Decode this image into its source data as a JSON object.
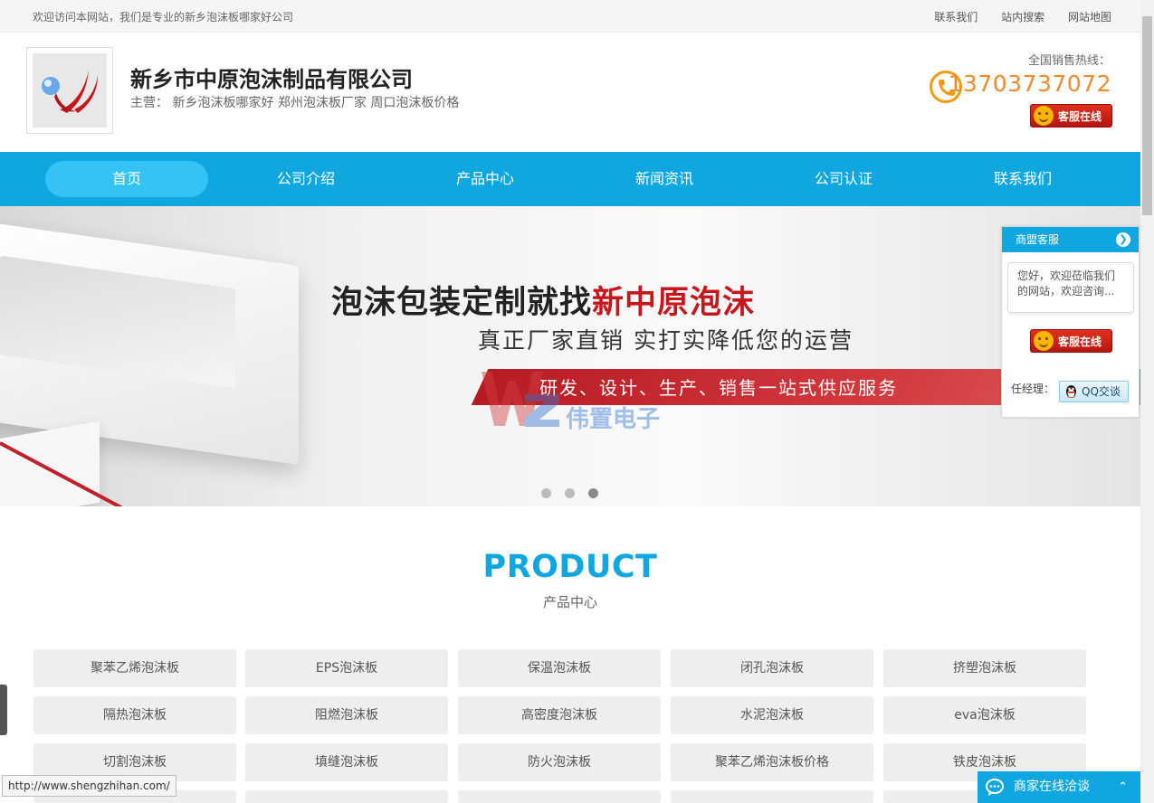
{
  "topbar": {
    "welcome": "欢迎访问本网站，我们是专业的新乡泡沫板哪家好公司",
    "links": [
      "联系我们",
      "站内搜索",
      "网站地图"
    ]
  },
  "header": {
    "company_name": "新乡市中原泡沫制品有限公司",
    "main_business": "主营： 新乡泡沫板哪家好 郑州泡沫板厂家 周口泡沫板价格",
    "hotline_label": "全国销售热线：",
    "phone": "13703737072",
    "kf_label": "客服在线"
  },
  "nav": {
    "items": [
      "首页",
      "公司介绍",
      "产品中心",
      "新闻资讯",
      "公司认证",
      "联系我们"
    ],
    "active_index": 0
  },
  "banner": {
    "headline_black": "泡沫包装定制就找",
    "headline_red": "新中原泡沫",
    "subline": "真正厂家直销 实打实降低您的运营",
    "redbar_text": "研发、设计、生产、销售一站式供应服务",
    "watermark_text": "伟置电子",
    "slides": 3,
    "active_slide": 2
  },
  "product": {
    "title": "PRODUCT",
    "subtitle": "产品中心",
    "categories": [
      "聚苯乙烯泡沫板",
      "EPS泡沫板",
      "保温泡沫板",
      "闭孔泡沫板",
      "挤塑泡沫板",
      "隔热泡沫板",
      "阻燃泡沫板",
      "高密度泡沫板",
      "水泥泡沫板",
      "eva泡沫板",
      "切割泡沫板",
      "填缝泡沫板",
      "防火泡沫板",
      "聚苯乙烯泡沫板价格",
      "铁皮泡沫板"
    ]
  },
  "float_panel": {
    "title": "商盟客服",
    "greeting": "您好，欢迎莅临我们的网站，欢迎咨询...",
    "kf_label": "客服在线",
    "manager_label": "任经理：",
    "qq_label": "QQ交谈"
  },
  "chat_bar": {
    "label": "商家在线洽谈"
  },
  "status_url": "http://www.shengzhihan.com/",
  "colors": {
    "brand_blue": "#10a7e0",
    "phone_orange": "#f08a2c",
    "brand_red": "#c8161d"
  }
}
